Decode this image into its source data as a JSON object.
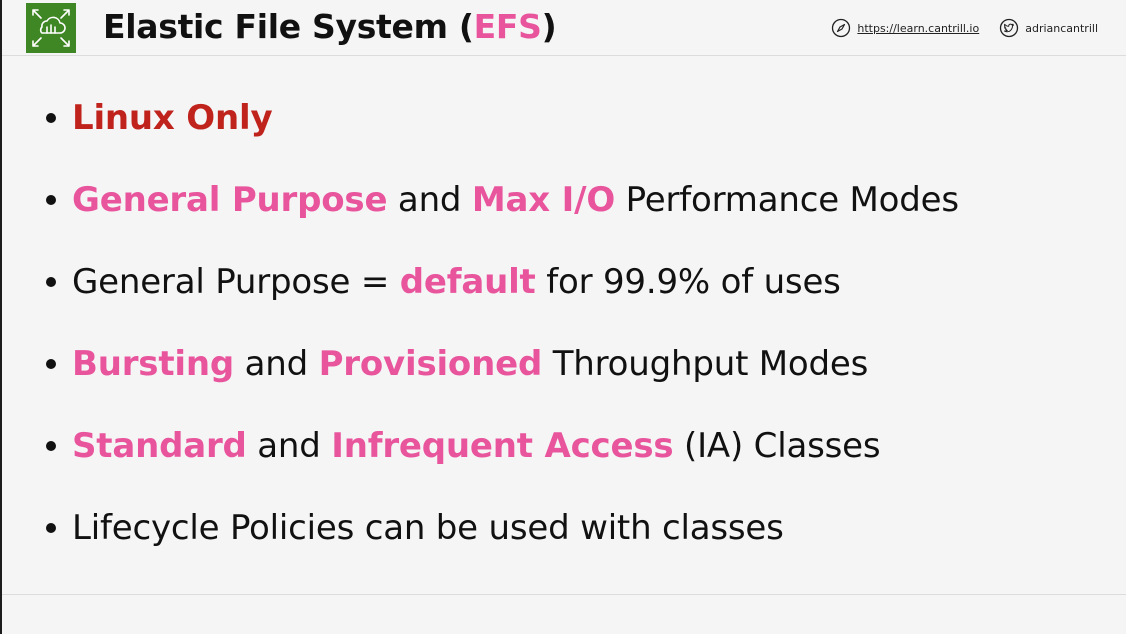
{
  "header": {
    "title_main": "Elastic File System (",
    "title_accent": "EFS",
    "title_end": ")",
    "website": "https://learn.cantrill.io",
    "twitter": "adriancantrill",
    "logo_icon": "aws-efs-icon",
    "website_icon": "compass-icon",
    "twitter_icon": "twitter-icon"
  },
  "colors": {
    "accent_pink": "#e8559d",
    "accent_red": "#c0221c",
    "logo_green": "#3f8624"
  },
  "bullets": [
    {
      "parts": [
        {
          "text": "Linux Only",
          "style": "red"
        }
      ]
    },
    {
      "parts": [
        {
          "text": "General Purpose",
          "style": "pink"
        },
        {
          "text": " and ",
          "style": "plain"
        },
        {
          "text": "Max I/O",
          "style": "pink"
        },
        {
          "text": " Performance Modes",
          "style": "plain"
        }
      ]
    },
    {
      "parts": [
        {
          "text": "General Purpose = ",
          "style": "plain"
        },
        {
          "text": "default",
          "style": "pink"
        },
        {
          "text": " for 99.9% of uses",
          "style": "plain"
        }
      ]
    },
    {
      "parts": [
        {
          "text": "Bursting",
          "style": "pink"
        },
        {
          "text": " and ",
          "style": "plain"
        },
        {
          "text": "Provisioned",
          "style": "pink"
        },
        {
          "text": " Throughput Modes",
          "style": "plain"
        }
      ]
    },
    {
      "parts": [
        {
          "text": "Standard",
          "style": "pink"
        },
        {
          "text": " and ",
          "style": "plain"
        },
        {
          "text": "Infrequent Access",
          "style": "pink"
        },
        {
          "text": " (IA) Classes",
          "style": "plain"
        }
      ]
    },
    {
      "parts": [
        {
          "text": "Lifecycle Policies can be used with classes",
          "style": "plain"
        }
      ]
    }
  ]
}
